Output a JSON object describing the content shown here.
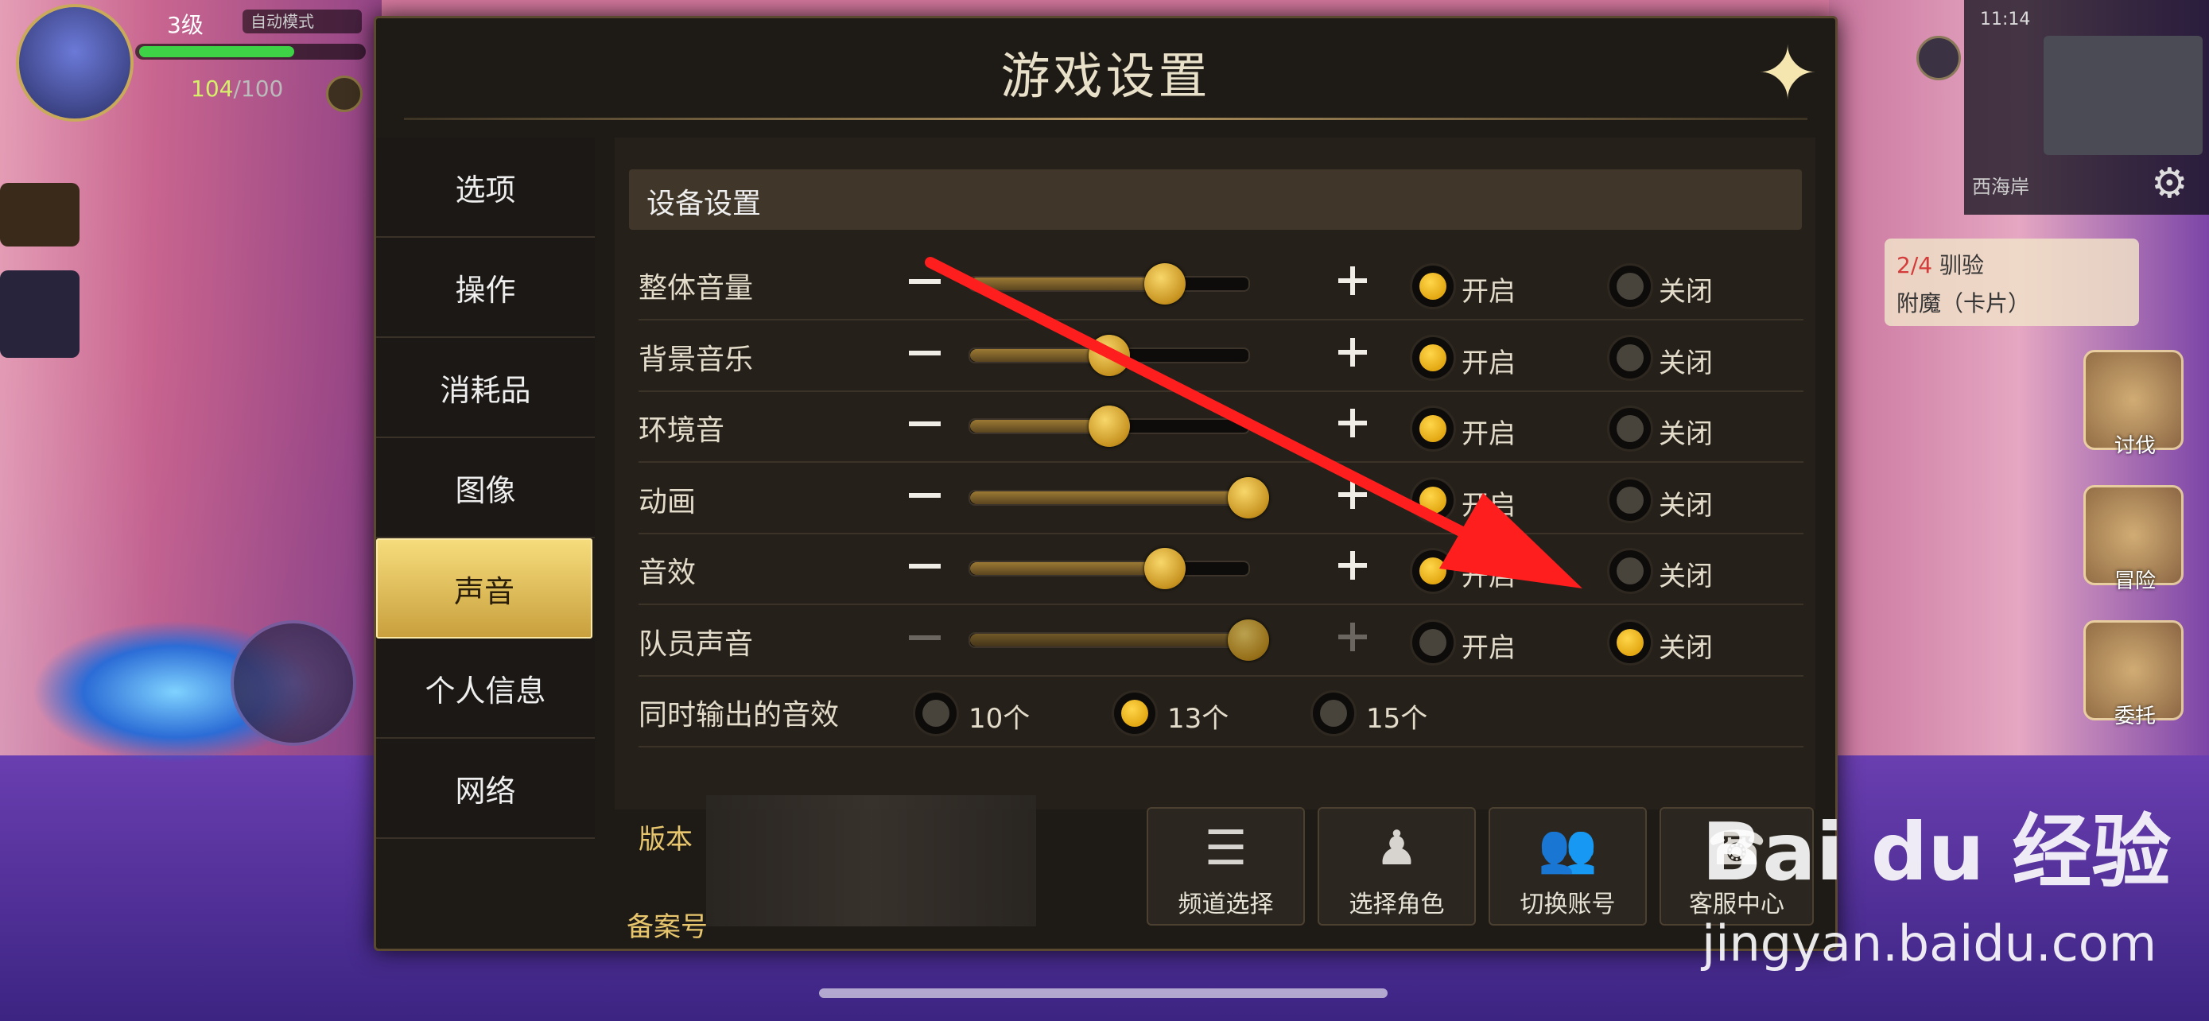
{
  "hud": {
    "level": "3级",
    "auto_button": "自动模式",
    "hp_current": "104",
    "hp_max": "/100",
    "time": "11:14",
    "location": "西海岸",
    "quest_line1_highlight": "2/4",
    "quest_line1": " 驯验",
    "quest_line2": "附魔（卡片）",
    "side_buttons": [
      "讨伐",
      "冒险",
      "委托"
    ]
  },
  "dialog": {
    "title": "游戏设置",
    "close_icon": "close-sparkle-icon"
  },
  "sidebar": {
    "items": [
      {
        "label": "选项",
        "active": false
      },
      {
        "label": "操作",
        "active": false
      },
      {
        "label": "消耗品",
        "active": false
      },
      {
        "label": "图像",
        "active": false
      },
      {
        "label": "声音",
        "active": true
      },
      {
        "label": "个人信息",
        "active": false
      },
      {
        "label": "网络",
        "active": false
      }
    ]
  },
  "settings": {
    "section_title": "设备设置",
    "on_label": "开启",
    "off_label": "关闭",
    "rows": [
      {
        "label": "整体音量",
        "level": 0.7,
        "enabled": true,
        "dimmed": false
      },
      {
        "label": "背景音乐",
        "level": 0.5,
        "enabled": true,
        "dimmed": false
      },
      {
        "label": "环境音",
        "level": 0.5,
        "enabled": true,
        "dimmed": false
      },
      {
        "label": "动画",
        "level": 1.0,
        "enabled": true,
        "dimmed": false
      },
      {
        "label": "音效",
        "level": 0.7,
        "enabled": true,
        "dimmed": false
      },
      {
        "label": "队员声音",
        "level": 1.0,
        "enabled": false,
        "dimmed": true
      }
    ],
    "simultaneous": {
      "label": "同时输出的音效",
      "options": [
        "10个",
        "13个",
        "15个"
      ],
      "selected": "13个"
    }
  },
  "footer": {
    "version_label": "版本",
    "record_label": "备案号",
    "buttons": [
      {
        "label": "频道选择",
        "icon": "list-icon"
      },
      {
        "label": "选择角色",
        "icon": "character-icon"
      },
      {
        "label": "切换账号",
        "icon": "users-icon"
      },
      {
        "label": "客服中心",
        "icon": "support-icon"
      }
    ]
  },
  "watermark": {
    "brand": "Bai du 经验",
    "url": "jingyan.baidu.com"
  },
  "colors": {
    "accent_gold": "#f2c94c",
    "annotation_arrow": "#ff1e1e",
    "panel_bg": "#1e1a16"
  }
}
